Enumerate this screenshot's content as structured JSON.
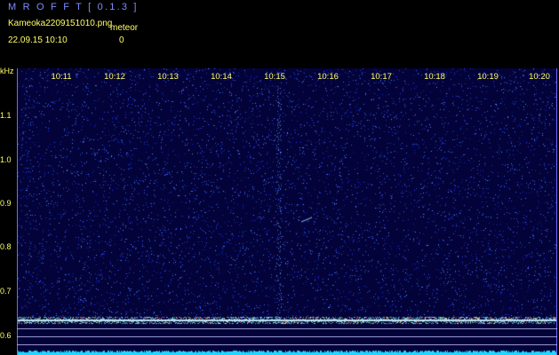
{
  "app": {
    "title": "M R O F F T  [ 0.1.3 ]"
  },
  "file": {
    "name": "Kameoka2209151010.png",
    "label": "meteor",
    "datetime": "22.09.15  10:10",
    "count": "0"
  },
  "axis": {
    "y_unit": "kHz",
    "y_ticks": [
      "1.1",
      "1.0",
      "0.9",
      "0.8",
      "0.7",
      "0.6"
    ],
    "x_ticks": [
      "10:11",
      "10:12",
      "10:13",
      "10:14",
      "10:15",
      "10:16",
      "10:17",
      "10:18",
      "10:19",
      "10:20"
    ]
  },
  "colors": {
    "background": "#03033a",
    "label": "#ffff66",
    "title": "#7f8cff"
  }
}
